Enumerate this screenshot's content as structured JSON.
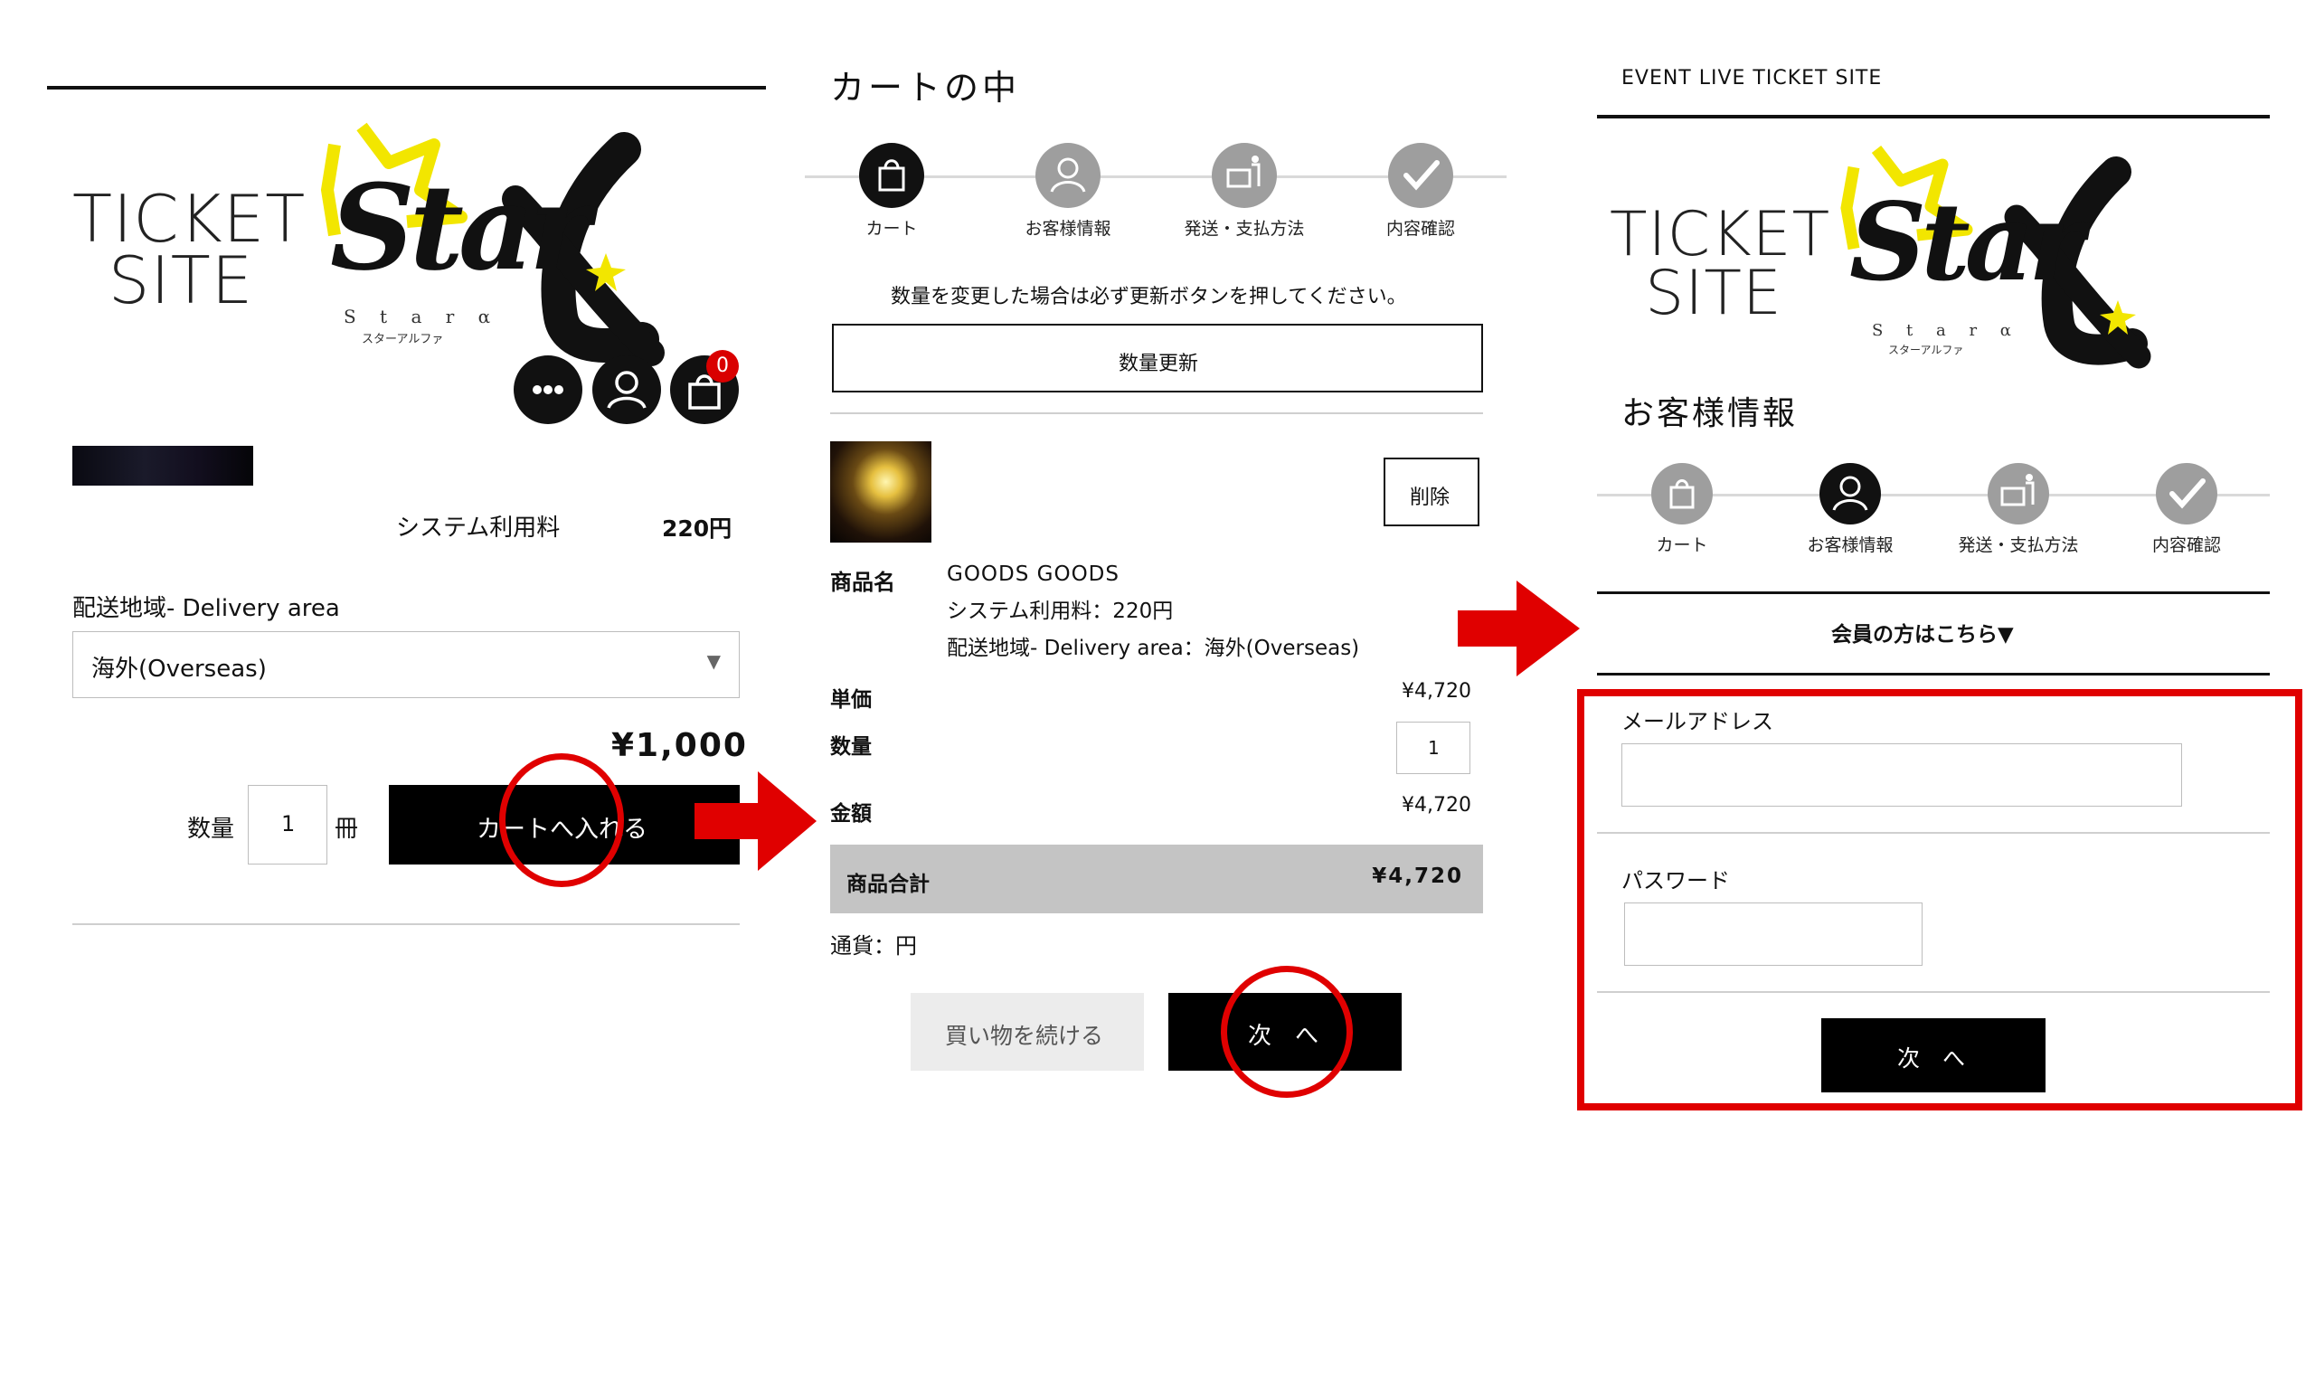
{
  "left": {
    "logo": {
      "line1": "TICKET",
      "line2": "SITE",
      "script": "Star",
      "alpha": "α",
      "latin": "S t a r  α",
      "kana": "スターアルファ"
    },
    "icons": {
      "more": "more-icon",
      "user": "user-icon",
      "cart": "cart-icon",
      "cart_count": "0"
    },
    "fee_label": "システム利用料",
    "fee_value": "220円",
    "delivery_label": "配送地域- Delivery area",
    "delivery_selected": "海外(Overseas)",
    "price": "¥1,000",
    "qty_label": "数量",
    "qty_value": "1",
    "qty_unit": "冊",
    "add_to_cart": "カートへ入れる"
  },
  "middle": {
    "title": "カートの中",
    "steps": [
      "カート",
      "お客様情報",
      "発送・支払方法",
      "内容確認"
    ],
    "notice": "数量を変更した場合は必ず更新ボタンを押してください。",
    "update_button": "数量更新",
    "delete_button": "削除",
    "item": {
      "name_label": "商品名",
      "name": "GOODS GOODS",
      "fee_line": "システム利用料：220円",
      "delivery_line": "配送地域- Delivery area：海外(Overseas)",
      "unit_price_label": "単価",
      "unit_price": "¥4,720",
      "qty_label": "数量",
      "qty": "1",
      "amount_label": "金額",
      "amount": "¥4,720"
    },
    "subtotal_label": "商品合計",
    "subtotal": "¥4,720",
    "currency": "通貨：円",
    "continue_button": "買い物を続ける",
    "next_button": "次　へ"
  },
  "right": {
    "site_title": "EVENT LIVE TICKET SITE",
    "page_title": "お客様情報",
    "steps": [
      "カート",
      "お客様情報",
      "発送・支払方法",
      "内容確認"
    ],
    "member_link": "会員の方はこちら▼",
    "email_label": "メールアドレス",
    "email_value": "",
    "password_label": "パスワード",
    "password_value": "",
    "next_button": "次　へ"
  },
  "colors": {
    "accent_red": "#e00000",
    "black": "#000000",
    "step_gray": "#9e9e9e",
    "star_yellow": "#f2e600"
  }
}
